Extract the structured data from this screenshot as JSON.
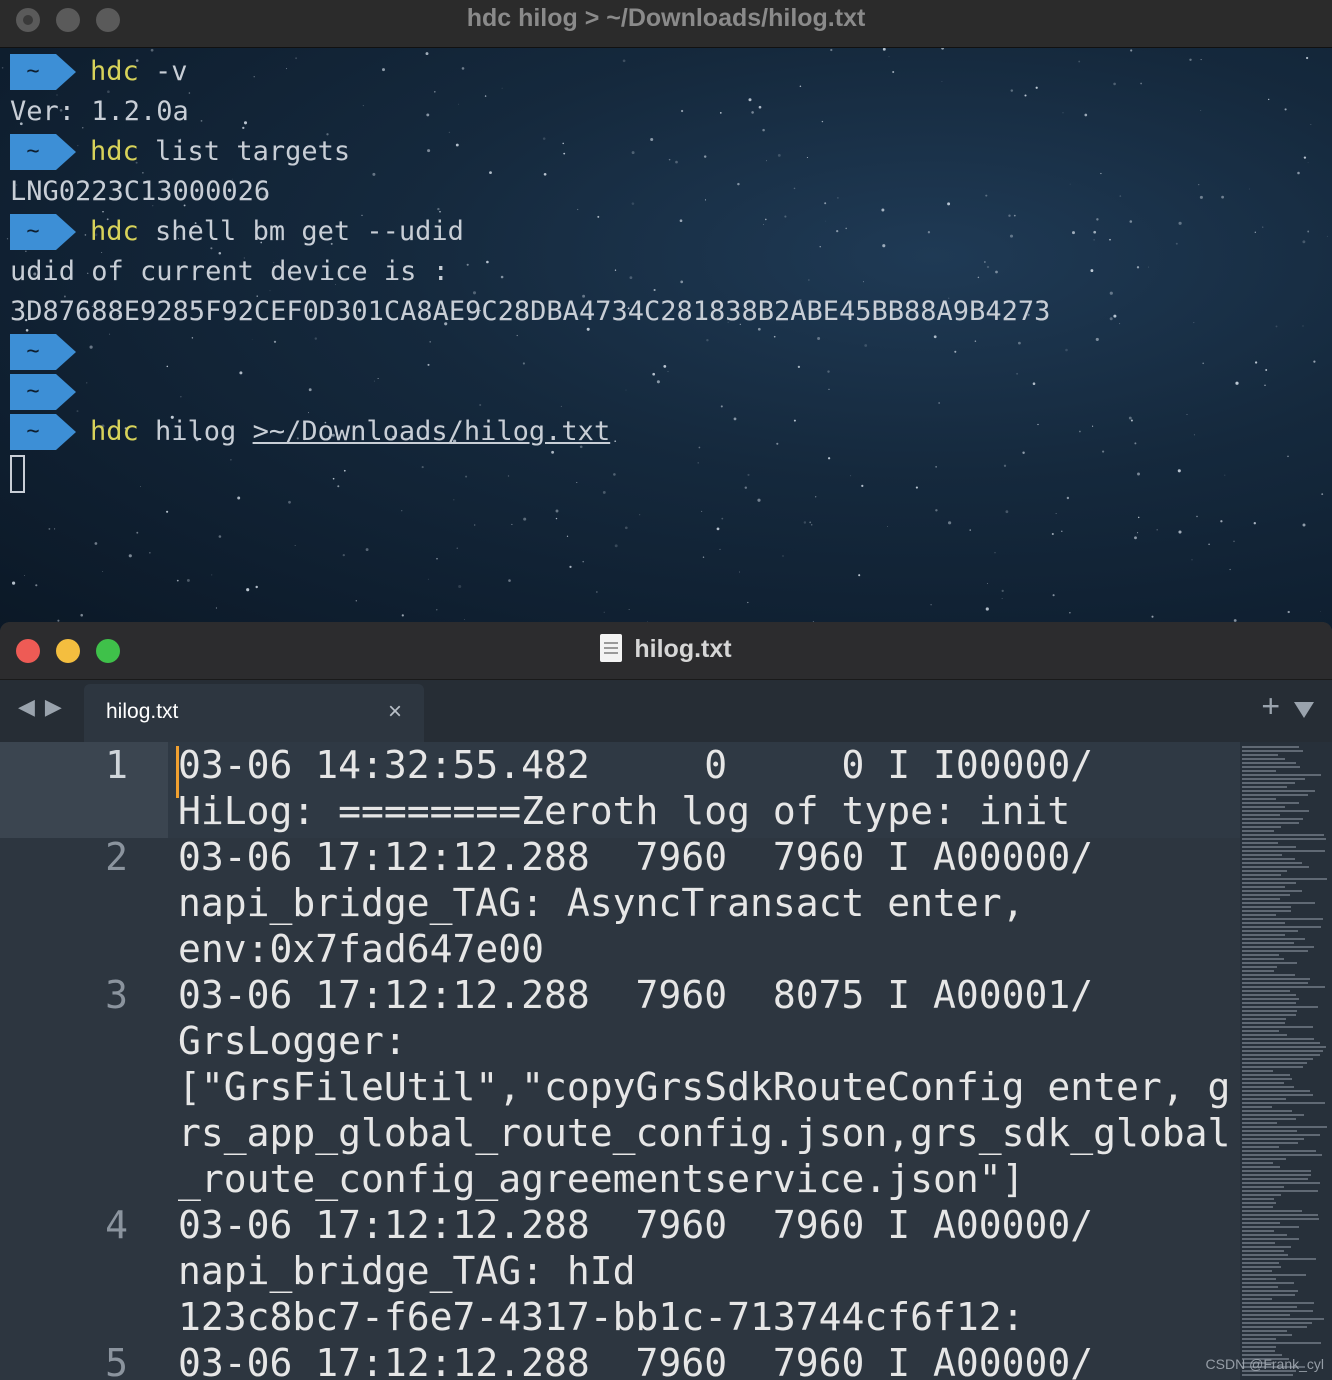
{
  "terminal": {
    "title": "hdc hilog > ~/Downloads/hilog.txt",
    "prompt_symbol": "~",
    "lines": [
      {
        "kind": "prompt",
        "kw": "hdc",
        "rest": " -v"
      },
      {
        "kind": "output",
        "text": "Ver: 1.2.0a"
      },
      {
        "kind": "prompt",
        "kw": "hdc",
        "rest": " list targets"
      },
      {
        "kind": "output",
        "text": "LNG0223C13000026"
      },
      {
        "kind": "prompt",
        "kw": "hdc",
        "rest": " shell bm get --udid"
      },
      {
        "kind": "output",
        "text": "udid of current device is :"
      },
      {
        "kind": "output",
        "text": "3D87688E9285F92CEF0D301CA8AE9C28DBA4734C281838B2ABE45BB88A9B4273"
      },
      {
        "kind": "prompt",
        "kw": "",
        "rest": ""
      },
      {
        "kind": "prompt",
        "kw": "",
        "rest": ""
      },
      {
        "kind": "prompt",
        "kw": "hdc",
        "rest": " hilog ",
        "redirect": ">~/Downloads/hilog.txt"
      }
    ]
  },
  "editor": {
    "title": "hilog.txt",
    "tab_label": "hilog.txt",
    "close_glyph": "×",
    "plus_glyph": "+",
    "back_glyph": "◀",
    "forward_glyph": "▶",
    "watermark": "CSDN @Frank_cyl",
    "lines": [
      {
        "number": "1",
        "rows": [
          "03-06 14:32:55.482     0     0 I I00000/",
          "HiLog: ========Zeroth log of type: init"
        ]
      },
      {
        "number": "2",
        "rows": [
          "03-06 17:12:12.288  7960  7960 I A00000/",
          "napi_bridge_TAG: AsyncTransact enter,",
          "env:0x7fad647e00"
        ]
      },
      {
        "number": "3",
        "rows": [
          "03-06 17:12:12.288  7960  8075 I A00001/",
          "GrsLogger:",
          "[\"GrsFileUtil\",\"copyGrsSdkRouteConfig enter, g",
          "rs_app_global_route_config.json,grs_sdk_global",
          "_route_config_agreementservice.json\"]"
        ]
      },
      {
        "number": "4",
        "rows": [
          "03-06 17:12:12.288  7960  7960 I A00000/",
          "napi_bridge_TAG: hId",
          "123c8bc7-f6e7-4317-bb1c-713744cf6f12:"
        ]
      },
      {
        "number": "5",
        "rows": [
          "03-06 17:12:12.288  7960  7960 I A00000/"
        ]
      }
    ]
  }
}
